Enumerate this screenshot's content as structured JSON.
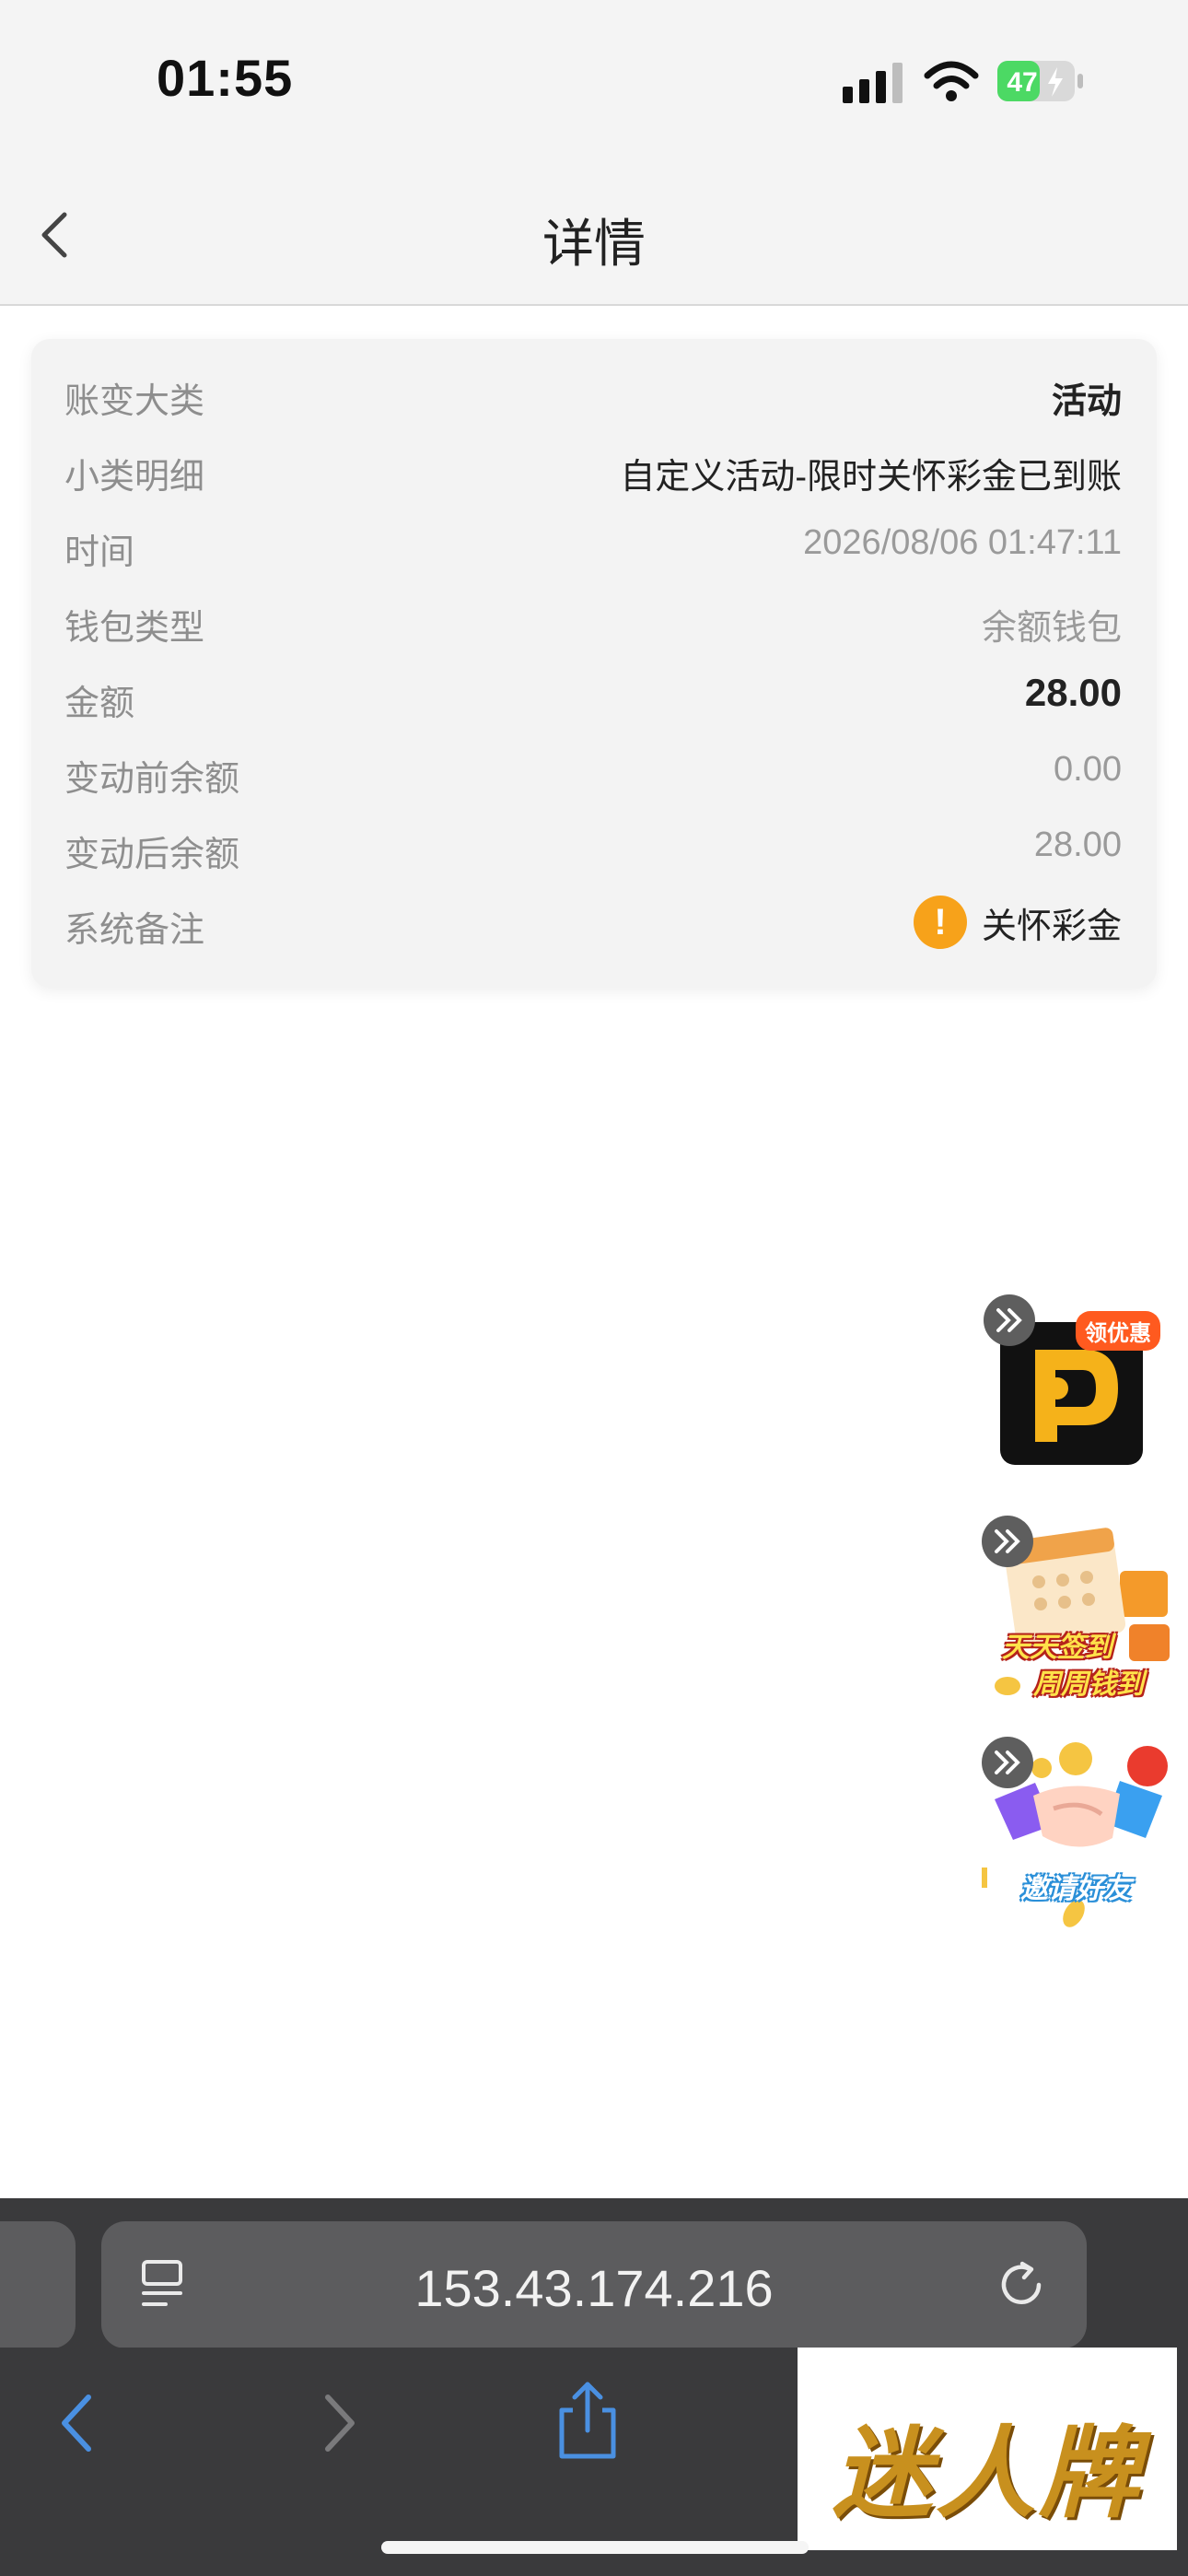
{
  "status_bar": {
    "time": "01:55",
    "battery": "47"
  },
  "nav": {
    "title": "详情"
  },
  "details": [
    {
      "label": "账变大类",
      "value": "活动"
    },
    {
      "label": "小类明细",
      "value": "自定义活动-限时关怀彩金已到账"
    },
    {
      "label": "时间",
      "value": "2026/08/06 01:47:11"
    },
    {
      "label": "钱包类型",
      "value": "余额钱包"
    },
    {
      "label": "金额",
      "value": "28.00"
    },
    {
      "label": "变动前余额",
      "value": "0.00"
    },
    {
      "label": "变动后余额",
      "value": "28.00"
    },
    {
      "label": "系统备注",
      "value": "关怀彩金"
    }
  ],
  "promos": {
    "coupon_tag": "领优惠",
    "checkin_line1": "天天签到",
    "checkin_line2": "周周钱到",
    "invite": "邀请好友"
  },
  "browser": {
    "url": "153.43.174.216"
  },
  "watermark": "迷人牌",
  "colors": {
    "warning": "#f7a21a",
    "promo_tag": "#ff5a1f",
    "toolbar_bg": "#3a3a3c",
    "link_blue": "#4a90e2"
  }
}
